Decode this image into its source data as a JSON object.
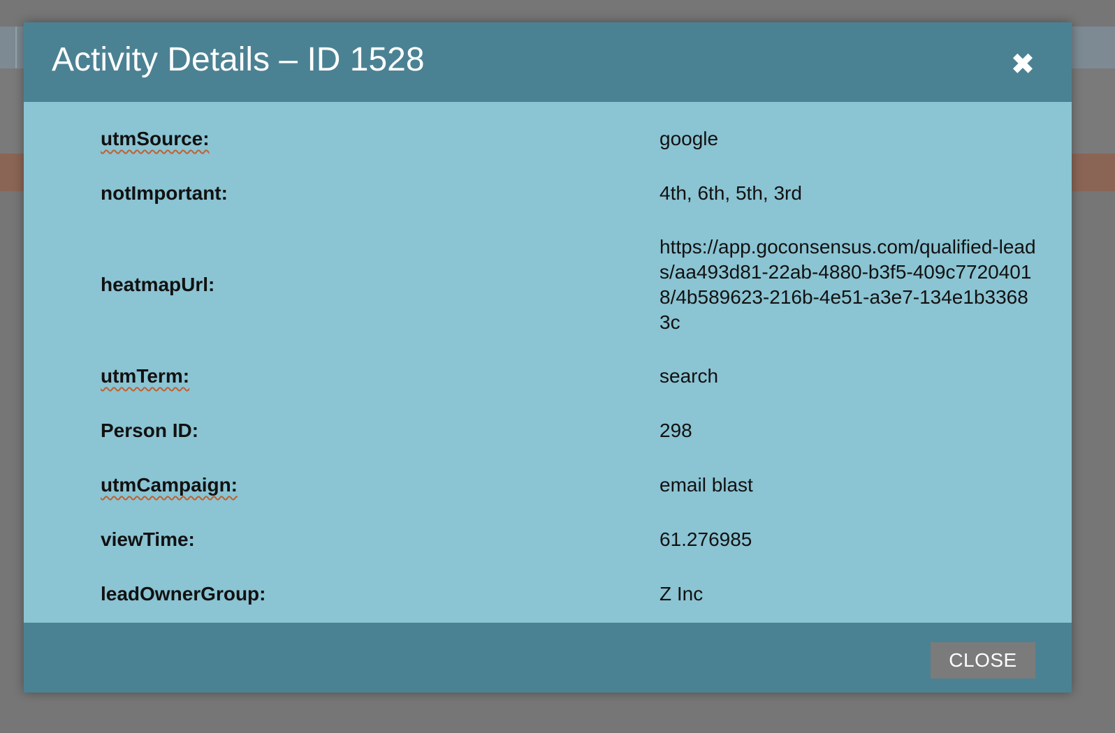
{
  "modal": {
    "title": "Activity Details – ID 1528",
    "close_icon": "close-x-icon",
    "close_button_label": "CLOSE"
  },
  "fields": [
    {
      "label": "utmSource:",
      "value": "google",
      "spellcheck_flag": true
    },
    {
      "label": "notImportant:",
      "value": "4th, 6th, 5th, 3rd",
      "spellcheck_flag": false
    },
    {
      "label": "heatmapUrl:",
      "value": "https://app.goconsensus.com/qualified-leads/aa493d81-22ab-4880-b3f5-409c77204018/4b589623-216b-4e51-a3e7-134e1b33683c",
      "spellcheck_flag": false
    },
    {
      "label": "utmTerm:",
      "value": "search",
      "spellcheck_flag": true
    },
    {
      "label": "Person ID:",
      "value": "298",
      "spellcheck_flag": false
    },
    {
      "label": "utmCampaign:",
      "value": "email blast",
      "spellcheck_flag": true
    },
    {
      "label": "viewTime:",
      "value": "61.276985",
      "spellcheck_flag": false
    },
    {
      "label": "leadOwnerGroup:",
      "value": "Z Inc",
      "spellcheck_flag": false
    }
  ],
  "colors": {
    "header": "#4b8293",
    "body": "#8bc4d3",
    "close_button": "#7b7b7b",
    "overlay": "#767676"
  }
}
